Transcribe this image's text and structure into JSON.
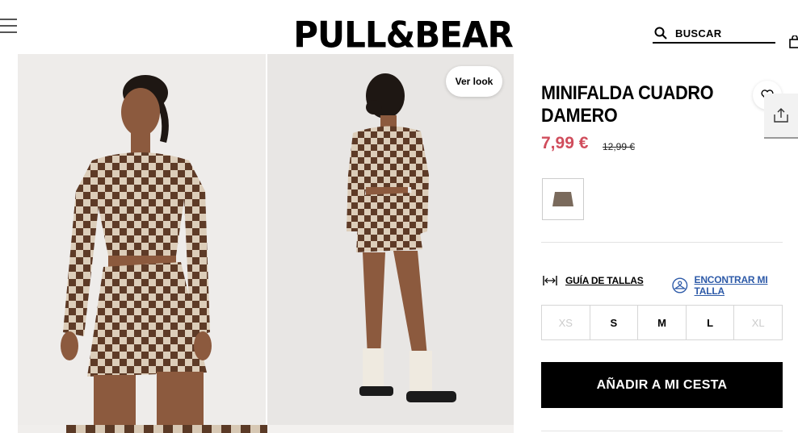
{
  "header": {
    "logo": "PULL&BEAR",
    "search_label": "BUSCAR"
  },
  "gallery": {
    "ver_look_label": "Ver look"
  },
  "product": {
    "title": "MINIFALDA CUADRO DAMERO",
    "price": "7,99 €",
    "old_price": "12,99 €",
    "price_color": "#d04d5c"
  },
  "sizes": {
    "guide_label": "GUÍA DE TALLAS",
    "find_label": "ENCONTRAR MI TALLA",
    "options": [
      {
        "label": "XS",
        "available": false
      },
      {
        "label": "S",
        "available": true
      },
      {
        "label": "M",
        "available": true
      },
      {
        "label": "L",
        "available": true
      },
      {
        "label": "XL",
        "available": false
      }
    ]
  },
  "actions": {
    "add_to_cart_label": "AÑADIR A MI CESTA"
  },
  "icons": [
    "menu-icon",
    "search-icon",
    "bag-icon",
    "heart-icon",
    "share-icon",
    "ruler-icon",
    "hanger-icon"
  ]
}
